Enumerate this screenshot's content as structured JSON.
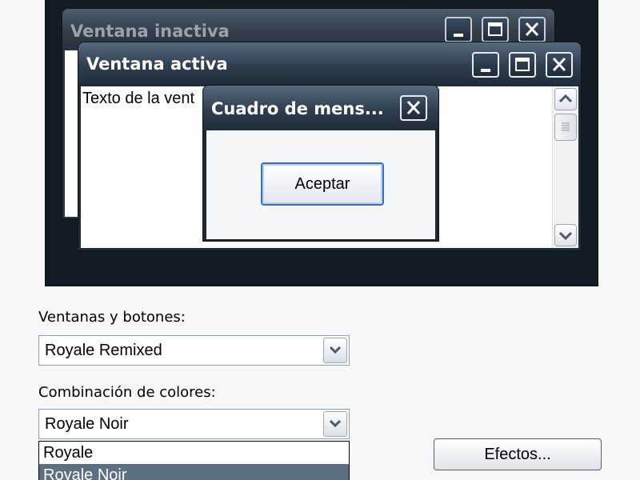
{
  "preview": {
    "inactive_window": {
      "title": "Ventana inactiva"
    },
    "active_window": {
      "title": "Ventana activa",
      "body_text": "Texto de la vent"
    },
    "message_box": {
      "title": "Cuadro de mens...",
      "ok_label": "Aceptar"
    }
  },
  "form": {
    "windows_buttons": {
      "label": "Ventanas y botones:",
      "value": "Royale Remixed"
    },
    "color_scheme": {
      "label": "Combinación de colores:",
      "value": "Royale Noir",
      "options": [
        "Royale",
        "Royale Noir"
      ],
      "highlighted_option": "Royale Noir"
    },
    "effects_label": "Efectos..."
  },
  "colors": {
    "preview_background": "#131b25",
    "selection_highlight": "#5d7082",
    "default_button_border": "#3b6fc2"
  },
  "icons": [
    "minimize-icon",
    "maximize-icon",
    "close-icon",
    "scroll-up-icon",
    "scroll-down-icon",
    "chevron-down-icon"
  ]
}
